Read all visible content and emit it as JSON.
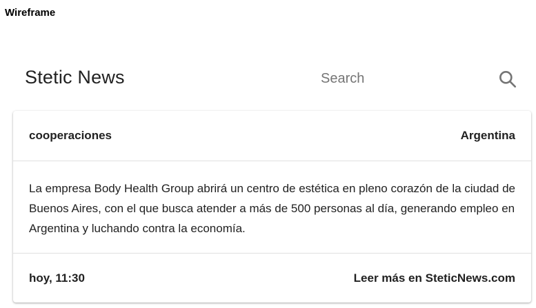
{
  "wireframe_label": "Wireframe",
  "header": {
    "brand": "Stetic News",
    "search_placeholder": "Search",
    "search_icon": "search-icon"
  },
  "article": {
    "category": "cooperaciones",
    "country": "Argentina",
    "body": "La empresa Body Health Group abrirá un centro de estética en pleno corazón de la ciudad de Buenos Aires, con el que busca atender a más de 500 personas al día, generando empleo en Argentina y luchando contra la economía.",
    "time": "hoy, 11:30",
    "read_more": "Leer más en SteticNews.com"
  }
}
